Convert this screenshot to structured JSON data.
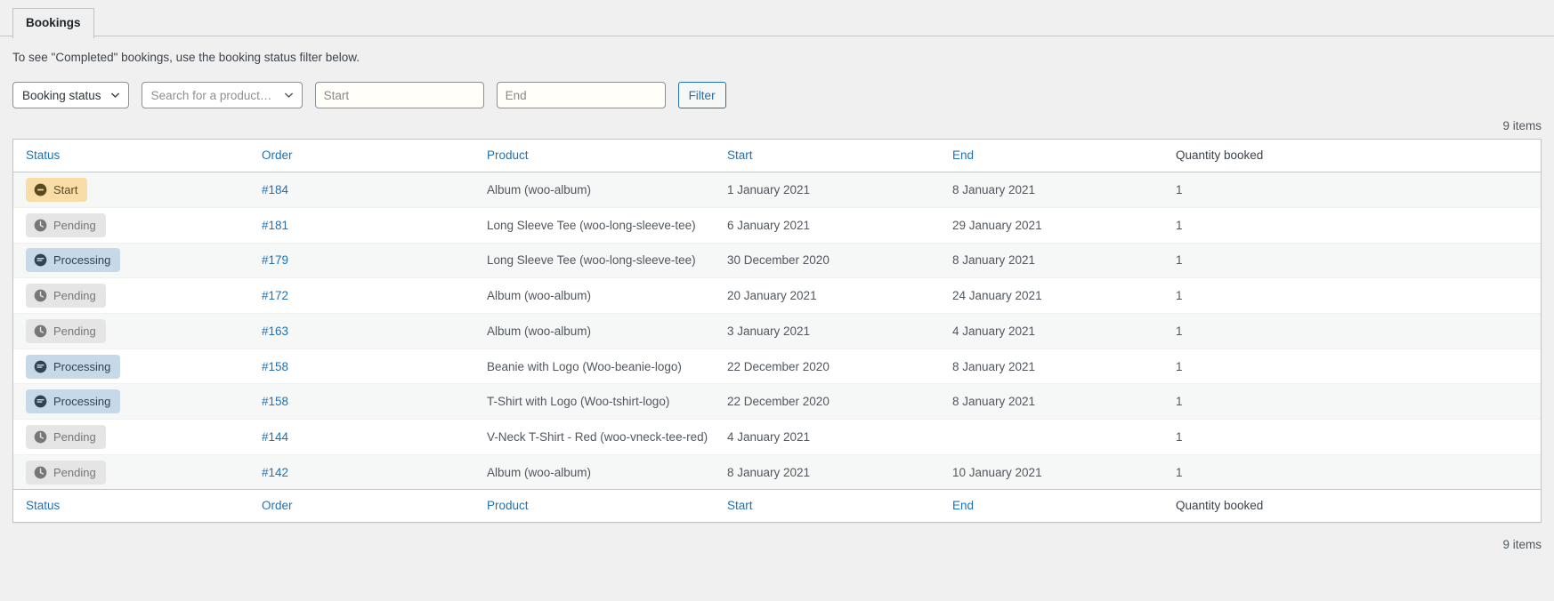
{
  "tab": {
    "label": "Bookings"
  },
  "notice": {
    "text": "To see \"Completed\" bookings, use the booking status filter below."
  },
  "filters": {
    "booking_status": {
      "label": "Booking status",
      "icon": "chevron-down-icon"
    },
    "product_search": {
      "placeholder": "Search for a product…",
      "icon": "chevron-down-icon"
    },
    "start": {
      "placeholder": "Start",
      "value": ""
    },
    "end": {
      "placeholder": "End",
      "value": ""
    },
    "filter_button": {
      "label": "Filter"
    }
  },
  "counts": {
    "top": "9 items",
    "bottom": "9 items"
  },
  "table": {
    "columns": [
      {
        "key": "status",
        "label": "Status",
        "link": true
      },
      {
        "key": "order",
        "label": "Order",
        "link": true
      },
      {
        "key": "product",
        "label": "Product",
        "link": true
      },
      {
        "key": "start",
        "label": "Start",
        "link": true
      },
      {
        "key": "end",
        "label": "End",
        "link": true
      },
      {
        "key": "quantity",
        "label": "Quantity booked",
        "link": false
      }
    ],
    "rows": [
      {
        "status": "Start",
        "status_kind": "start",
        "status_icon": "circle-minus-icon",
        "order": "#184",
        "product": "Album (woo-album)",
        "start": "1 January 2021",
        "end": "8 January 2021",
        "quantity": "1"
      },
      {
        "status": "Pending",
        "status_kind": "pending",
        "status_icon": "clock-icon",
        "order": "#181",
        "product": "Long Sleeve Tee (woo-long-sleeve-tee)",
        "start": "6 January 2021",
        "end": "29 January 2021",
        "quantity": "1"
      },
      {
        "status": "Processing",
        "status_kind": "processing",
        "status_icon": "comment-bubble-icon",
        "order": "#179",
        "product": "Long Sleeve Tee (woo-long-sleeve-tee)",
        "start": "30 December 2020",
        "end": "8 January 2021",
        "quantity": "1"
      },
      {
        "status": "Pending",
        "status_kind": "pending",
        "status_icon": "clock-icon",
        "order": "#172",
        "product": "Album (woo-album)",
        "start": "20 January 2021",
        "end": "24 January 2021",
        "quantity": "1"
      },
      {
        "status": "Pending",
        "status_kind": "pending",
        "status_icon": "clock-icon",
        "order": "#163",
        "product": "Album (woo-album)",
        "start": "3 January 2021",
        "end": "4 January 2021",
        "quantity": "1"
      },
      {
        "status": "Processing",
        "status_kind": "processing",
        "status_icon": "comment-bubble-icon",
        "order": "#158",
        "product": "Beanie with Logo (Woo-beanie-logo)",
        "start": "22 December 2020",
        "end": "8 January 2021",
        "quantity": "1"
      },
      {
        "status": "Processing",
        "status_kind": "processing",
        "status_icon": "comment-bubble-icon",
        "order": "#158",
        "product": "T-Shirt with Logo (Woo-tshirt-logo)",
        "start": "22 December 2020",
        "end": "8 January 2021",
        "quantity": "1"
      },
      {
        "status": "Pending",
        "status_kind": "pending",
        "status_icon": "clock-icon",
        "order": "#144",
        "product": "V-Neck T-Shirt - Red (woo-vneck-tee-red)",
        "start": "4 January 2021",
        "end": "",
        "quantity": "1"
      },
      {
        "status": "Pending",
        "status_kind": "pending",
        "status_icon": "clock-icon",
        "order": "#142",
        "product": "Album (woo-album)",
        "start": "8 January 2021",
        "end": "10 January 2021",
        "quantity": "1"
      }
    ]
  },
  "colors": {
    "link": "#2271b1",
    "page_bg": "#f0f0f1",
    "status_start_bg": "#f8dda7",
    "status_pending_bg": "#e5e5e5",
    "status_processing_bg": "#c6d9e9"
  }
}
